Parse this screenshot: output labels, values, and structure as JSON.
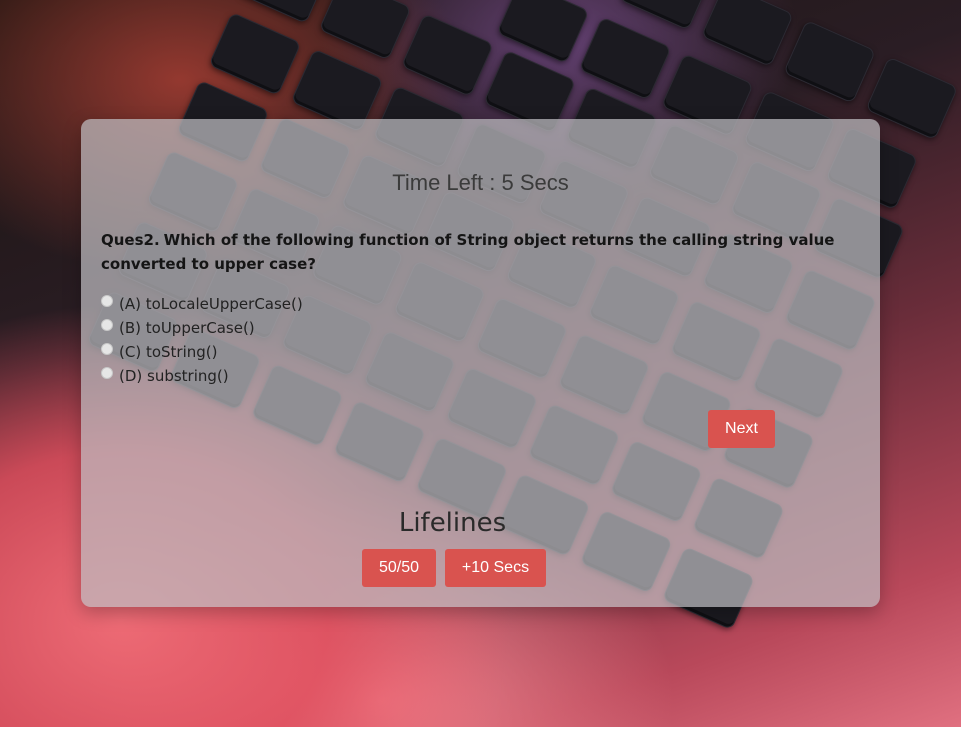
{
  "timer": {
    "text": "Time Left : 5 Secs"
  },
  "question": {
    "number": "Ques2.",
    "text": "Which of the following function of String object returns the calling string value converted to upper case?",
    "options": [
      {
        "label": "(A) toLocaleUpperCase()",
        "selected": false
      },
      {
        "label": "(B) toUpperCase()",
        "selected": false
      },
      {
        "label": "(C) toString()",
        "selected": false
      },
      {
        "label": "(D) substring()",
        "selected": false
      }
    ]
  },
  "buttons": {
    "next_label": "Next"
  },
  "lifelines": {
    "title": "Lifelines",
    "fifty_fifty_label": "50/50",
    "extra_time_label": "+10 Secs"
  },
  "colors": {
    "button_accent": "#d9534f",
    "card_background": "#bebcc0"
  }
}
